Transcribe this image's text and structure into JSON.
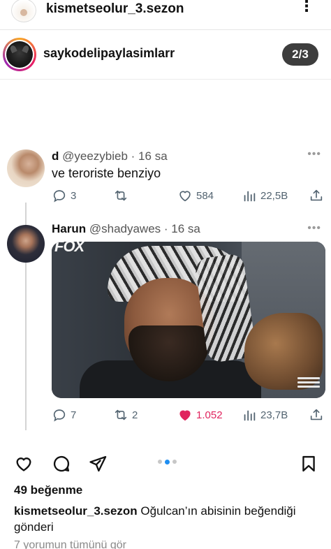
{
  "header": {
    "account": "kismetseolur_3.sezon",
    "menu_icon": "more-vertical-icon"
  },
  "post_owner": {
    "username": "saykodelipaylasimlarr",
    "carousel_counter": "2/3"
  },
  "tweets": [
    {
      "display_name": "d",
      "handle": "@yeezybieb",
      "time": "· 16 sa",
      "text": "ve teroriste benziyo",
      "replies": "3",
      "retweets": "",
      "likes": "584",
      "views": "22,5B",
      "liked": false
    },
    {
      "display_name": "Harun",
      "handle": "@shadyawes",
      "time": "· 16 sa",
      "media_logo": "FOX",
      "replies": "7",
      "retweets": "2",
      "likes": "1.052",
      "views": "23,7B",
      "liked": true
    }
  ],
  "colors": {
    "like_active": "#e0245e",
    "carousel_dot_active": "#1f8ef1",
    "action_gray": "#536471"
  },
  "post_footer": {
    "likes_text": "49 beğenme",
    "caption_user": "kismetseolur_3.sezon",
    "caption_text": " Oğulcan’ın abisinin beğendiği gönderi",
    "comments_text": "7 yorumun tümünü gör",
    "carousel_dots": 3,
    "carousel_active_index": 1
  }
}
